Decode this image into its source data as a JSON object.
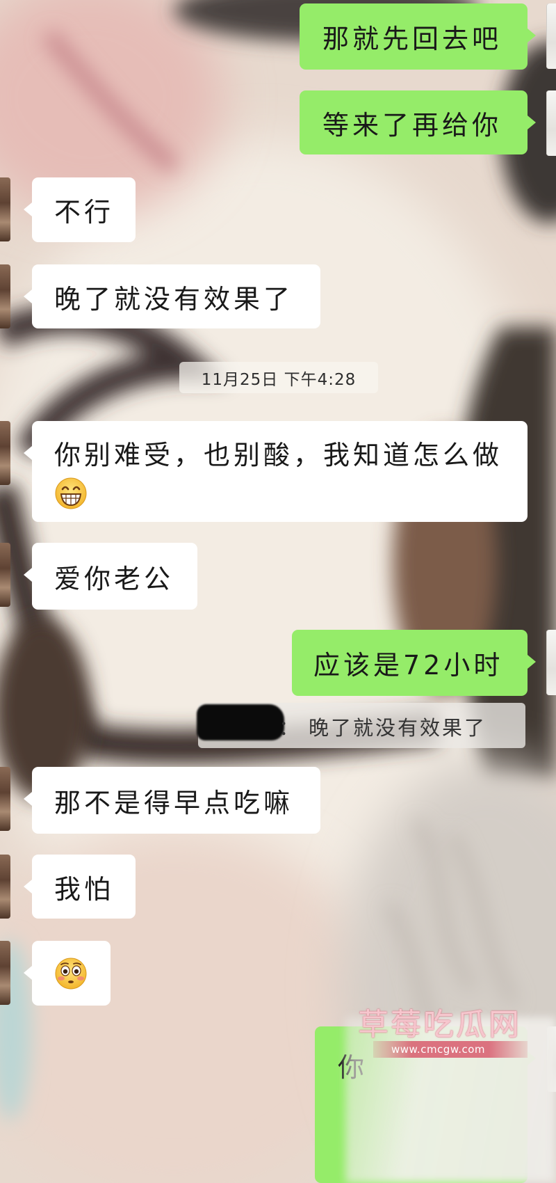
{
  "chat": {
    "messages": [
      {
        "side": "outgoing",
        "text": "那就先回去吧"
      },
      {
        "side": "outgoing",
        "text": "等来了再给你"
      },
      {
        "side": "incoming",
        "text": "不行"
      },
      {
        "side": "incoming",
        "text": "晚了就没有效果了"
      },
      {
        "side": "incoming",
        "text": "你别难受，也别酸，我知道怎么做",
        "emoji": "grin-emoji"
      },
      {
        "side": "incoming",
        "text": "爱你老公"
      },
      {
        "side": "outgoing",
        "text": "应该是72小时"
      },
      {
        "side": "incoming",
        "text": "那不是得早点吃嘛"
      },
      {
        "side": "incoming",
        "text": "我怕"
      },
      {
        "side": "incoming",
        "emoji": "flushed-emoji"
      },
      {
        "side": "outgoing",
        "text": "你"
      }
    ],
    "timestamp": "11月25日 下午4:28",
    "quote": {
      "separator": "：",
      "text": "晚了就没有效果了"
    }
  },
  "watermark": {
    "name": "草莓吃瓜网",
    "url": "www.cmcgw.com"
  },
  "colors": {
    "outgoing": "#95ec69",
    "incoming": "#ffffff"
  }
}
